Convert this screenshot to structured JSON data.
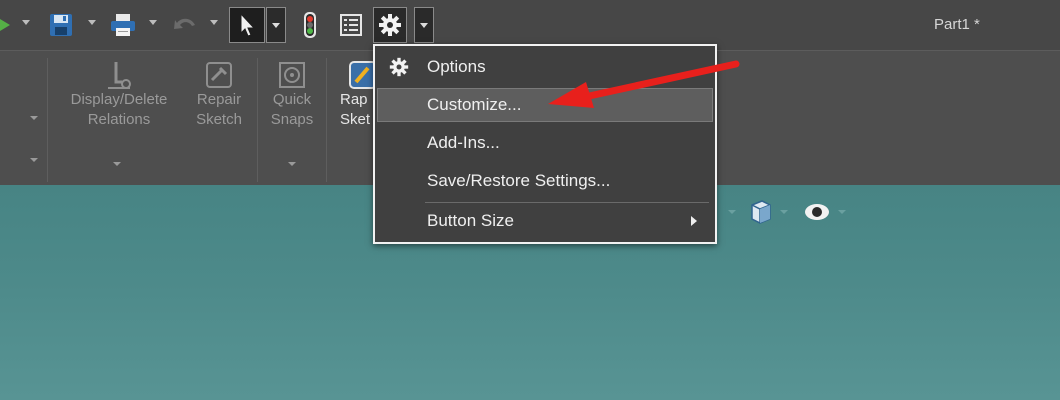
{
  "window": {
    "title": "Part1 *"
  },
  "ribbon": {
    "display_delete_relations": "Display/Delete Relations",
    "repair_sketch": "Repair Sketch",
    "quick_snaps": "Quick Snaps",
    "rapid_sketch_partial": "Rap Sket"
  },
  "options_menu": {
    "items": [
      {
        "label": "Options",
        "icon": "gear-icon"
      },
      {
        "label": "Customize...",
        "highlighted": true
      },
      {
        "label": "Add-Ins..."
      },
      {
        "label": "Save/Restore Settings..."
      },
      {
        "label": "Button Size",
        "has_submenu": true
      }
    ]
  },
  "colors": {
    "toolbar": "#474747",
    "ribbon": "#4e4e4e",
    "graphics_area": "#4a8686",
    "menu_bg": "#404040",
    "menu_highlight": "#5e5e5e",
    "annotation_arrow": "#e8201c"
  }
}
